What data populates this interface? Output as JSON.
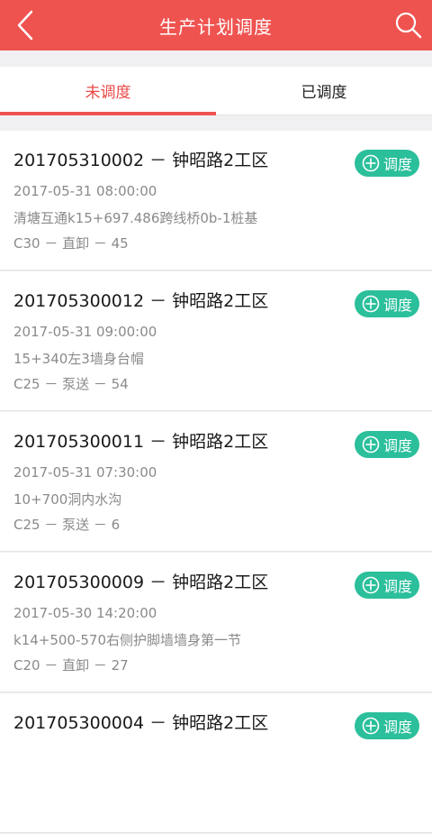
{
  "header": {
    "title": "生产计划调度",
    "background": "#ef5350"
  },
  "tabs": [
    {
      "label": "未调度",
      "active": true
    },
    {
      "label": "已调度",
      "active": false
    }
  ],
  "dispatch_label": "调度",
  "accent_green": "#2bbf9b",
  "items": [
    {
      "code": "201705310002 － 钟昭路2工区",
      "time": "2017-05-31 08:00:00",
      "location": "清塘互通k15+697.486跨线桥0b-1桩基",
      "spec": "C30 － 直卸 － 45"
    },
    {
      "code": "201705300012 － 钟昭路2工区",
      "time": "2017-05-31 09:00:00",
      "location": "15+340左3墙身台帽",
      "spec": "C25 － 泵送 － 54"
    },
    {
      "code": "201705300011 － 钟昭路2工区",
      "time": "2017-05-31 07:30:00",
      "location": "10+700洞内水沟",
      "spec": "C25 － 泵送 － 6"
    },
    {
      "code": "201705300009 － 钟昭路2工区",
      "time": "2017-05-30 14:20:00",
      "location": "k14+500-570右侧护脚墙墙身第一节",
      "spec": "C20 － 直卸 － 27"
    },
    {
      "code": "201705300004 － 钟昭路2工区",
      "time": "",
      "location": "",
      "spec": ""
    }
  ]
}
